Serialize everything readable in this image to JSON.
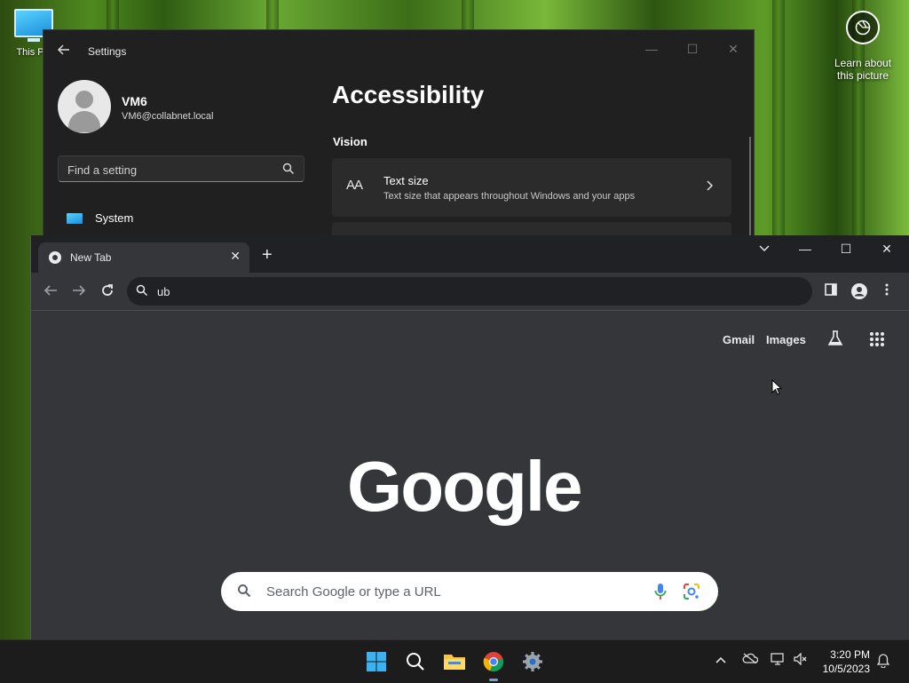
{
  "desktop": {
    "icon_label": "This PC",
    "learn_label_1": "Learn about",
    "learn_label_2": "this picture"
  },
  "settings": {
    "title": "Settings",
    "user_name": "VM6",
    "user_email": "VM6@collabnet.local",
    "search_placeholder": "Find a setting",
    "nav_item": "System",
    "page_title": "Accessibility",
    "section": "Vision",
    "card_title": "Text size",
    "card_desc": "Text size that appears throughout Windows and your apps",
    "card_icon": "AA"
  },
  "chrome": {
    "tab_title": "New Tab",
    "omnibox_value": "ub",
    "links": {
      "gmail": "Gmail",
      "images": "Images"
    },
    "logo": "Google",
    "search_placeholder": "Search Google or type a URL"
  },
  "taskbar": {
    "time": "3:20 PM",
    "date": "10/5/2023",
    "accent": "#7f9fbf"
  }
}
